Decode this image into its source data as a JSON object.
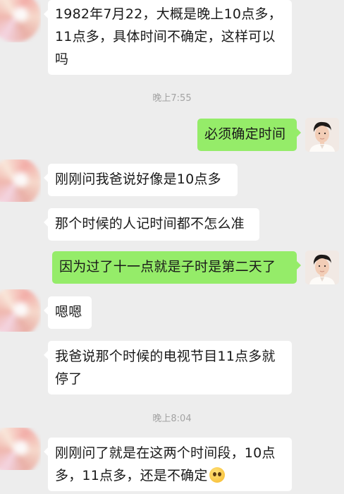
{
  "messages": [
    {
      "side": "left",
      "text": "1982年7月22，大概是晚上10点多，11点多，具体时间不确定，这样可以吗"
    },
    {
      "side": "right",
      "text": "必须确定时间"
    },
    {
      "side": "left",
      "text": "刚刚问我爸说好像是10点多"
    },
    {
      "side": "left",
      "text": "那个时候的人记时间都不怎么准"
    },
    {
      "side": "right",
      "text": "因为过了十一点就是子时是第二天了"
    },
    {
      "side": "left",
      "text": "嗯嗯"
    },
    {
      "side": "left",
      "text": "我爸说那个时候的电视节目11点多就停了"
    },
    {
      "side": "left",
      "text": "刚刚问了就是在这两个时间段，10点多，11点多，还是不确定",
      "emoji": "flushed-face-icon"
    }
  ],
  "timestamps": [
    "晚上7:55",
    "晚上8:04"
  ],
  "colors": {
    "background": "#ededed",
    "bubble_mine": "#95ec69",
    "bubble_other": "#ffffff",
    "timestamp": "#a3a3a3"
  }
}
